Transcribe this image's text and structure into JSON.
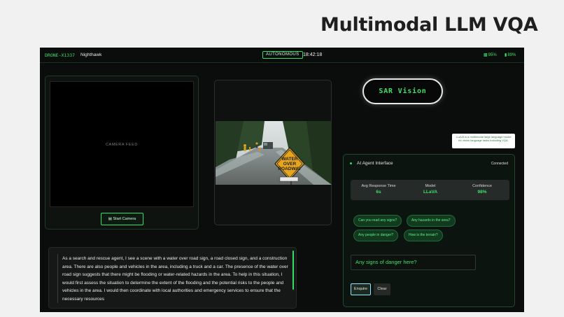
{
  "slide": {
    "title": "Multimodal LLM VQA"
  },
  "topbar": {
    "drone_id": "DRONE-X1337",
    "drone_name": "Nighthawk",
    "mode": "AUTONOMOUS",
    "clock": "18:42:18",
    "signal_icon": "signal-icon",
    "signal": "95%",
    "battery_icon": "battery-icon",
    "battery": "89%"
  },
  "camera": {
    "label": "CAMERA FEED",
    "start_button": "Start Camera",
    "button_icon": "camera-icon"
  },
  "scene_image": {
    "sign_text": [
      "WATER",
      "OVER",
      "ROADWAY"
    ]
  },
  "brand": {
    "label": "SAR Vision"
  },
  "tooltip": {
    "text": "LLaVA is a multimodal large language model for vision language tasks including VQA."
  },
  "agent": {
    "title": "AI Agent Interface",
    "status": "Connected",
    "metrics": [
      {
        "label": "Avg Response Time",
        "value": "6s"
      },
      {
        "label": "Model",
        "value": "LLaVA"
      },
      {
        "label": "Confidence",
        "value": "98%"
      }
    ],
    "suggestions": [
      "Can you read any signs?",
      "Any hazards in the area?",
      "Any people in danger?",
      "How is the terrain?"
    ],
    "query_value": "Any signs of danger here?",
    "enquire_button": "Enquire",
    "clear_button": "Clear"
  },
  "response": {
    "text": "As a search and rescue agent, I see a scene with a water over road sign, a road closed sign, and a construction area. There are also people and vehicles in the area, including a truck and a car. The presence of the water over road sign suggests that there might be flooding or water-related hazards in the area. To help in this situation, I would first assess the situation to determine the extent of the flooding and the potential risks to the people and vehicles in the area. I would then coordinate with local authorities and emergency services to ensure that the necessary resources"
  },
  "colors": {
    "accent": "#3ee06a",
    "background": "#0b0d0c",
    "slide_bg": "#f1f1f1"
  }
}
